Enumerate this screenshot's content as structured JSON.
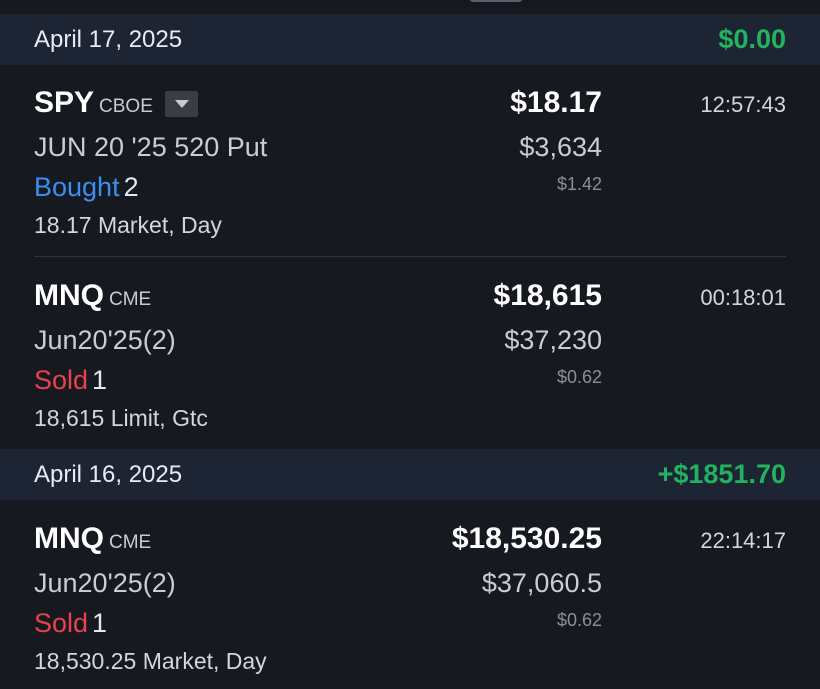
{
  "groups": [
    {
      "date": "April 17, 2025",
      "pnl": "$0.00",
      "orders": [
        {
          "symbol": "SPY",
          "exchange": "CBOE",
          "contract": "JUN 20 '25 520 Put",
          "side": "Bought",
          "qty": "2",
          "detail": "18.17 Market, Day",
          "price": "$18.17",
          "notional": "$3,634",
          "fee": "$1.42",
          "time": "12:57:43"
        },
        {
          "symbol": "MNQ",
          "exchange": "CME",
          "contract": "Jun20'25(2)",
          "side": "Sold",
          "qty": "1",
          "detail": "18,615 Limit, Gtc",
          "price": "$18,615",
          "notional": "$37,230",
          "fee": "$0.62",
          "time": "00:18:01"
        }
      ]
    },
    {
      "date": "April 16, 2025",
      "pnl": "+$1851.70",
      "orders": [
        {
          "symbol": "MNQ",
          "exchange": "CME",
          "contract": "Jun20'25(2)",
          "side": "Sold",
          "qty": "1",
          "detail": "18,530.25 Market, Day",
          "price": "$18,530.25",
          "notional": "$37,060.5",
          "fee": "$0.62",
          "time": "22:14:17"
        }
      ]
    }
  ],
  "colors": {
    "background": "#16191f",
    "date_header": "#1d2535",
    "positive": "#23b25d",
    "buy": "#3c8ef0",
    "sell": "#e8414f"
  },
  "icons": {
    "dropdown": "chevron-down-icon"
  }
}
